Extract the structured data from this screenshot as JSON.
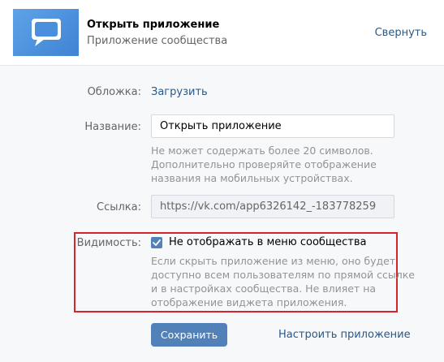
{
  "header": {
    "app_title": "Открыть приложение",
    "app_subtitle": "Приложение сообщества",
    "collapse_label": "Свернуть"
  },
  "form": {
    "cover": {
      "label": "Обложка:",
      "action": "Загрузить"
    },
    "name": {
      "label": "Название:",
      "value": "Открыть приложение",
      "hint_lines": [
        "Не может содержать более 20 символов.",
        "Дополнительно проверяйте отображение",
        "названия на мобильных устройствах."
      ]
    },
    "link": {
      "label": "Ссылка:",
      "value": "https://vk.com/app6326142_-183778259"
    },
    "visibility": {
      "label": "Видимость:",
      "checkbox_label": "Не отображать в меню сообщества",
      "checked": true,
      "hint_lines": [
        "Если скрыть приложение из меню, оно будет",
        "доступно всем пользователям по прямой ссылке",
        "и в настройках сообщества. Не влияет на",
        "отображение виджета приложения."
      ]
    },
    "save_label": "Сохранить",
    "configure_label": "Настроить приложение"
  },
  "colors": {
    "accent": "#5181b8",
    "link": "#2a5885",
    "highlight_border": "#d7242c"
  },
  "icons": {
    "app": "chat-bubble-icon",
    "checkbox": "checkmark-icon"
  }
}
